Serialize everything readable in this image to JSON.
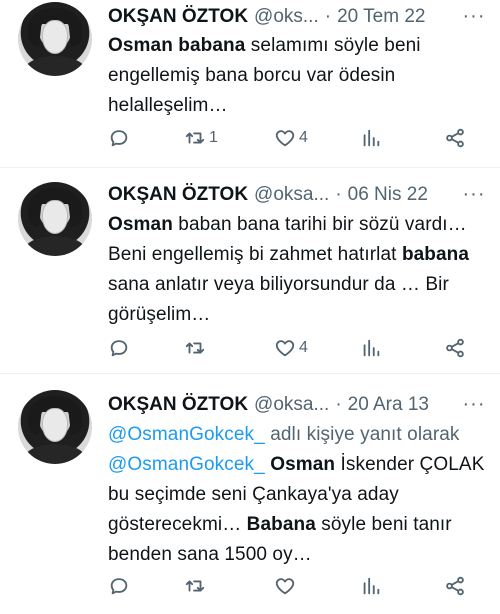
{
  "tweets": [
    {
      "name": "OKŞAN ÖZTOK",
      "handle": "@oks...",
      "date": "20 Tem 22",
      "body_parts": [
        {
          "b": "Osman babana"
        },
        {
          "t": " selamımı söyle beni engellemiş bana borcu var ödesin helalleşelim…"
        }
      ],
      "reply_count": "",
      "retweet_count": "1",
      "like_count": "4"
    },
    {
      "name": "OKŞAN ÖZTOK",
      "handle": "@oksa...",
      "date": "06 Nis 22",
      "body_parts": [
        {
          "b": "Osman"
        },
        {
          "t": " baban bana tarihi bir sözü vardı… Beni engellemiş bi zahmet hatırlat "
        },
        {
          "b": "babana"
        },
        {
          "t": " sana anlatır veya biliyorsundur da … Bir görüşelim…"
        }
      ],
      "reply_count": "",
      "retweet_count": "",
      "like_count": "4"
    },
    {
      "name": "OKŞAN ÖZTOK",
      "handle": "@oksa...",
      "date": "20 Ara 13",
      "reply_prefix": "@OsmanGokcek_",
      "reply_suffix": " adlı kişiye yanıt olarak",
      "body_parts": [
        {
          "m": "@OsmanGokcek_"
        },
        {
          "t": " "
        },
        {
          "b": "Osman"
        },
        {
          "t": " İskender ÇOLAK bu seçimde seni Çankaya'ya aday gösterecekmi… "
        },
        {
          "b": "Babana"
        },
        {
          "t": " söyle beni tanır benden sana 1500 oy…"
        }
      ],
      "reply_count": "",
      "retweet_count": "",
      "like_count": ""
    }
  ],
  "icons": [
    "reply-icon",
    "retweet-icon",
    "like-icon",
    "views-icon",
    "share-icon",
    "more-icon"
  ],
  "colors": {
    "text": "#0f1419",
    "muted": "#536471",
    "link": "#1d9bf0",
    "divider": "#eff3f4"
  }
}
